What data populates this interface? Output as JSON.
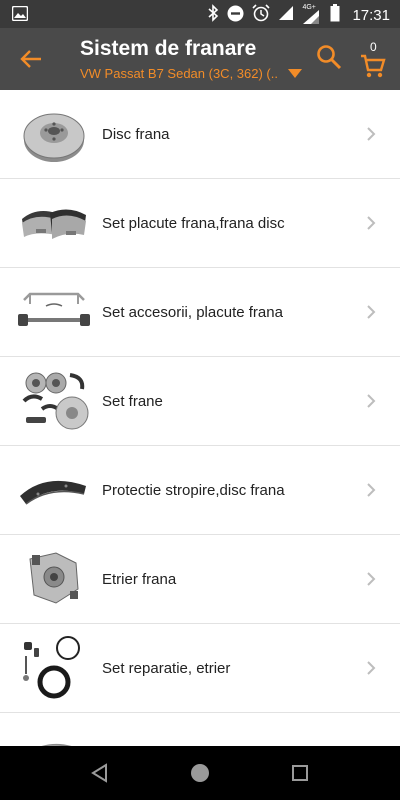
{
  "status_bar": {
    "time": "17:31",
    "network": "4G+",
    "icons": [
      "image-icon",
      "bluetooth-icon",
      "do-not-disturb-icon",
      "alarm-icon",
      "signal-icon",
      "battery-icon"
    ]
  },
  "app_bar": {
    "title": "Sistem de franare",
    "subtitle": "VW Passat B7 Sedan (3C, 362) (...",
    "cart_count": "0",
    "icons": [
      "back-arrow-icon",
      "dropdown-triangle-icon",
      "search-icon",
      "cart-icon"
    ]
  },
  "colors": {
    "accent": "#f28c28",
    "app_bar": "#4a4a4a",
    "status_bar": "#3a3a3a",
    "text": "#222222",
    "divider": "#e2e2e2"
  },
  "categories": [
    {
      "label": "Disc frana"
    },
    {
      "label": "Set placute frana,frana disc"
    },
    {
      "label": "Set accesorii, placute frana"
    },
    {
      "label": "Set frane"
    },
    {
      "label": "Protectie stropire,disc frana"
    },
    {
      "label": "Etrier frana"
    },
    {
      "label": "Set reparatie, etrier"
    },
    {
      "label": ""
    }
  ],
  "nav_bar": {
    "icons": [
      "back-triangle-icon",
      "home-circle-icon",
      "recents-square-icon"
    ]
  }
}
